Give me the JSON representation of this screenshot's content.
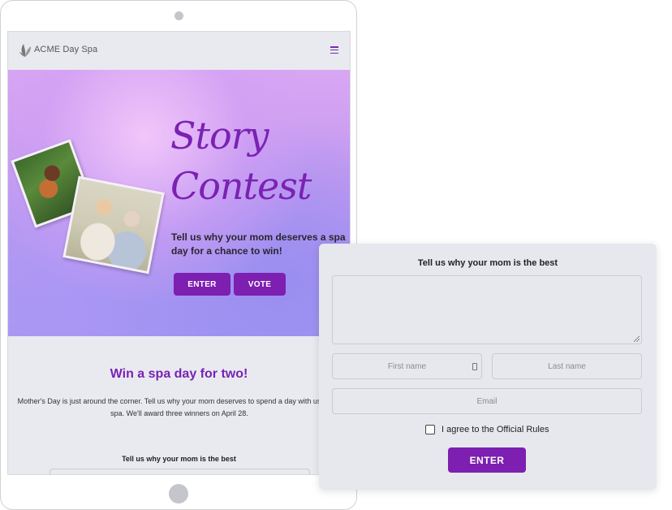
{
  "site": {
    "brand_name": "ACME Day Spa"
  },
  "hero": {
    "title_line1": "Story",
    "title_line2": "Contest",
    "subtitle": "Tell us why your mom deserves a spa day for a chance to win!",
    "enter_label": "ENTER",
    "vote_label": "VOTE"
  },
  "promo": {
    "heading": "Win a spa day for two!",
    "body": "Mother's Day is just around the corner. Tell us why your mom deserves to spend a day with us at the spa. We'll award three winners on April 28.",
    "form_title": "Tell us why your mom is the best"
  },
  "form": {
    "title": "Tell us why your mom is the best",
    "first_name_placeholder": "First name",
    "last_name_placeholder": "Last name",
    "email_placeholder": "Email",
    "agree_label": "I agree to the Official Rules",
    "agree_checked": false,
    "submit_label": "ENTER"
  },
  "colors": {
    "accent": "#7d1fb0",
    "title_purple": "#7a22b3",
    "page_bg": "#e8eaf0"
  },
  "icons": {
    "logo": "leaf-icon",
    "menu": "hamburger-menu-icon"
  }
}
